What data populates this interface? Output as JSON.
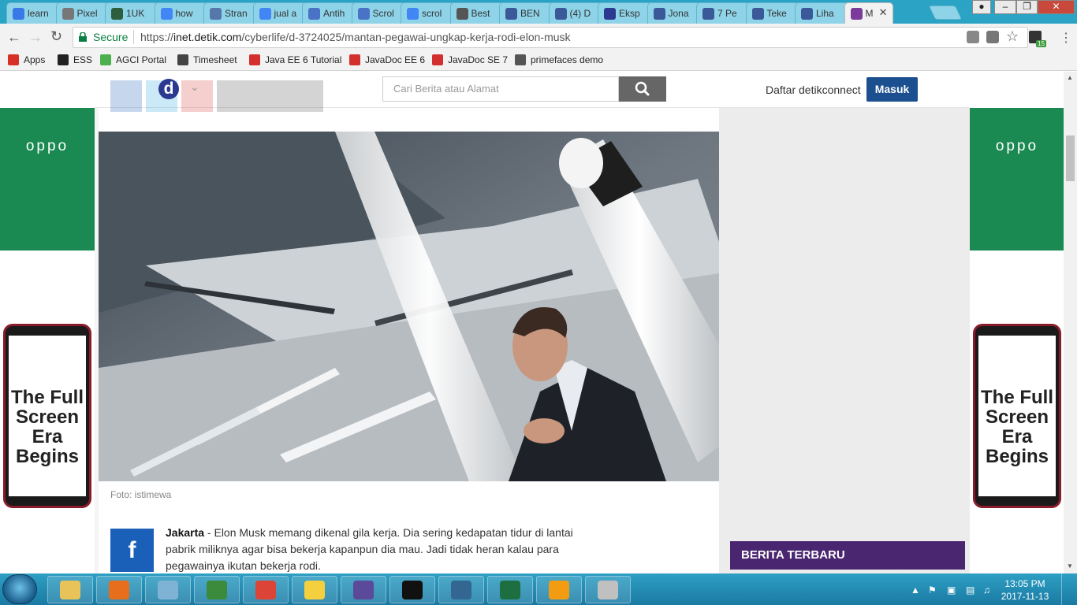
{
  "browser": {
    "tabs": [
      {
        "label": "learn",
        "icon": "doc-icon",
        "color": "#3b78e7"
      },
      {
        "label": "Pixel",
        "icon": "wikipedia-icon",
        "color": "#777777"
      },
      {
        "label": "1UK",
        "icon": "info-icon",
        "color": "#2d5f3c"
      },
      {
        "label": "how",
        "icon": "google-icon",
        "color": "#4285f4"
      },
      {
        "label": "Stran",
        "icon": "translate-icon",
        "color": "#5577aa"
      },
      {
        "label": "jual a",
        "icon": "google-icon",
        "color": "#4285f4"
      },
      {
        "label": "Antih",
        "icon": "a-icon",
        "color": "#4a73c7"
      },
      {
        "label": "Scrol",
        "icon": "s-icon",
        "color": "#4a73c7"
      },
      {
        "label": "scrol",
        "icon": "google-icon",
        "color": "#4285f4"
      },
      {
        "label": "Best",
        "icon": "robot-icon",
        "color": "#555555"
      },
      {
        "label": "BEN",
        "icon": "b-icon",
        "color": "#3b5998"
      },
      {
        "label": "(4) D",
        "icon": "facebook-icon",
        "color": "#3b5998"
      },
      {
        "label": "Eksp",
        "icon": "d-icon",
        "color": "#2b3990"
      },
      {
        "label": "Jona",
        "icon": "facebook-icon",
        "color": "#3b5998"
      },
      {
        "label": "7 Pe",
        "icon": "facebook-icon",
        "color": "#3b5998"
      },
      {
        "label": "Teke",
        "icon": "facebook-icon",
        "color": "#3b5998"
      },
      {
        "label": "Liha",
        "icon": "facebook-icon",
        "color": "#3b5998"
      },
      {
        "label": "M",
        "icon": "info-icon",
        "color": "#7b3b9a"
      }
    ],
    "secure_label": "Secure",
    "url_scheme": "https://",
    "url_host": "inet.detik.com",
    "url_path": "/cyberlife/d-3724025/mantan-pegawai-ungkap-kerja-rodi-elon-musk",
    "extension_badge": "15",
    "bookmarks": [
      {
        "label": "Apps",
        "icon": "apps-grid-icon",
        "color": "#d93025"
      },
      {
        "label": "ESS",
        "icon": "ess-icon",
        "color": "#222222"
      },
      {
        "label": "AGCI Portal",
        "icon": "agci-icon",
        "color": "#4caf50"
      },
      {
        "label": "Timesheet",
        "icon": "timesheet-icon",
        "color": "#444444"
      },
      {
        "label": "Java EE 6 Tutorial",
        "icon": "oracle-icon",
        "color": "#d32f2f"
      },
      {
        "label": "JavaDoc EE 6",
        "icon": "oracle-icon",
        "color": "#d32f2f"
      },
      {
        "label": "JavaDoc SE 7",
        "icon": "oracle-icon",
        "color": "#d32f2f"
      },
      {
        "label": "primefaces demo",
        "icon": "primefaces-icon",
        "color": "#555555"
      }
    ]
  },
  "header": {
    "logo_letter": "d",
    "search_placeholder": "Cari Berita atau Alamat",
    "register_label": "Daftar detikconnect",
    "login_label": "Masuk"
  },
  "ads": {
    "brand": "oppo",
    "slogan": "The Full Screen Era Begins",
    "brand_color": "#1b8a52"
  },
  "article": {
    "photo_caption": "Foto: istimewa",
    "dateline": "Jakarta",
    "body": " - Elon Musk memang dikenal gila kerja. Dia sering kedapatan tidur di lantai pabrik miliknya agar bisa bekerja kapanpun dia mau. Jadi tidak heran kalau para pegawainya ikutan bekerja rodi."
  },
  "sidebar": {
    "section_title": "BERITA TERBARU",
    "section_color": "#4a2570"
  },
  "taskbar": {
    "apps": [
      "explorer",
      "firefox",
      "notepad",
      "timesheet",
      "chrome",
      "sticky-notes",
      "java-ee-ide",
      "inkscape",
      "postgresql",
      "excel",
      "vlc",
      "paint"
    ],
    "time": "13:05 PM",
    "date": "2017-11-13"
  }
}
